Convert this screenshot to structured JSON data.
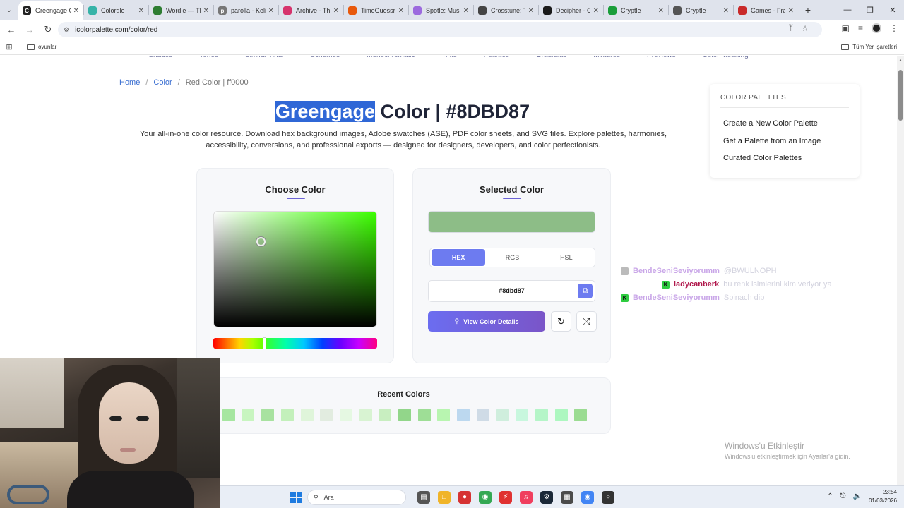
{
  "browser": {
    "tabs": [
      {
        "title": "Greengage C",
        "active": true,
        "favicon_color": "#222222",
        "favicon_glyph": "C"
      },
      {
        "title": "Colordle",
        "active": false,
        "favicon_color": "#36b3a8",
        "favicon_glyph": ""
      },
      {
        "title": "Wordle — Th",
        "active": false,
        "favicon_color": "#2e7d32",
        "favicon_glyph": ""
      },
      {
        "title": "parolla - Keli",
        "active": false,
        "favicon_color": "#777777",
        "favicon_glyph": "p"
      },
      {
        "title": "Archive - Th",
        "active": false,
        "favicon_color": "#d6336c",
        "favicon_glyph": ""
      },
      {
        "title": "TimeGuessr",
        "active": false,
        "favicon_color": "#e8590c",
        "favicon_glyph": ""
      },
      {
        "title": "Spotle: Musi",
        "active": false,
        "favicon_color": "#9c6ade",
        "favicon_glyph": ""
      },
      {
        "title": "Crosstune: T",
        "active": false,
        "favicon_color": "#444444",
        "favicon_glyph": ""
      },
      {
        "title": "Decipher - C",
        "active": false,
        "favicon_color": "#1b1b1b",
        "favicon_glyph": ""
      },
      {
        "title": "Cryptle",
        "active": false,
        "favicon_color": "#1a9e3a",
        "favicon_glyph": ""
      },
      {
        "title": "Cryptle",
        "active": false,
        "favicon_color": "#555555",
        "favicon_glyph": ""
      },
      {
        "title": "Games - Fra",
        "active": false,
        "favicon_color": "#c92a2a",
        "favicon_glyph": ""
      }
    ],
    "url": "icolorpalette.com/color/red",
    "bookmark_folder": "oyunlar",
    "all_bookmarks": "Tüm Yer İşaretleri"
  },
  "sitenav": {
    "items": [
      "Shades",
      "Tones",
      "Similar Tints",
      "Schemes",
      "Monochromatic",
      "Tints",
      "Palettes",
      "Gradients",
      "Mixtures",
      "Previews",
      "Color Meaning"
    ]
  },
  "breadcrumb": {
    "home": "Home",
    "color": "Color",
    "sep": "/",
    "current": "Red Color | ff0000"
  },
  "page": {
    "title_highlight": "Greengage",
    "title_rest": " Color | #8DBD87",
    "intro": "Your all-in-one color resource. Download hex background images, Adobe swatches (ASE), PDF color sheets, and SVG files. Explore palettes, harmonies, accessibility, conversions, and professional exports — designed for designers, developers, and color perfectionists."
  },
  "picker": {
    "title": "Choose Color"
  },
  "selected": {
    "title": "Selected Color",
    "color": "#8dbd87",
    "modes": [
      "HEX",
      "RGB",
      "HSL"
    ],
    "active_mode": "HEX",
    "hex_value": "#8dbd87",
    "view_button": "View Color Details"
  },
  "recent": {
    "title": "Recent Colors",
    "colors": [
      "#96d68c",
      "#a6e6a0",
      "#c8f5c0",
      "#a8e2a0",
      "#c3f0bb",
      "#dff5da",
      "#e2ece0",
      "#e5f8e2",
      "#d8f3d2",
      "#c8eec0",
      "#92d68a",
      "#9ede96",
      "#b8f5b0",
      "#bcd8ef",
      "#cfdbe6",
      "#cfeedd",
      "#c8f7de",
      "#b5f5c8",
      "#adf7c0",
      "#9bdc92"
    ]
  },
  "sidebar": {
    "heading": "COLOR PALETTES",
    "links": [
      "Create a New Color Palette",
      "Get a Palette from an Image",
      "Curated Color Palettes"
    ]
  },
  "chat": [
    {
      "user": "BendeSeniSeviyorumm",
      "message": "@BWULNOPH",
      "user_color": "#c9a6e8",
      "badge_color": "#bbbbbb"
    },
    {
      "user": "ladycanberk",
      "message": "bu renk isimlerini kim veriyor ya",
      "user_color": "#b0174b",
      "badge_color": "#2ecc40"
    },
    {
      "user": "BendeSeniSeviyorumm",
      "message": "Spinach dip",
      "user_color": "#c9a6e8",
      "badge_color": "#2ecc40"
    }
  ],
  "watermark": {
    "line1": "Windows'u Etkinleştir",
    "line2": "Windows'u etkinleştirmek için Ayarlar'a gidin."
  },
  "taskbar": {
    "search_placeholder": "Ara",
    "time": "23:54",
    "date": "01/03/2026"
  }
}
